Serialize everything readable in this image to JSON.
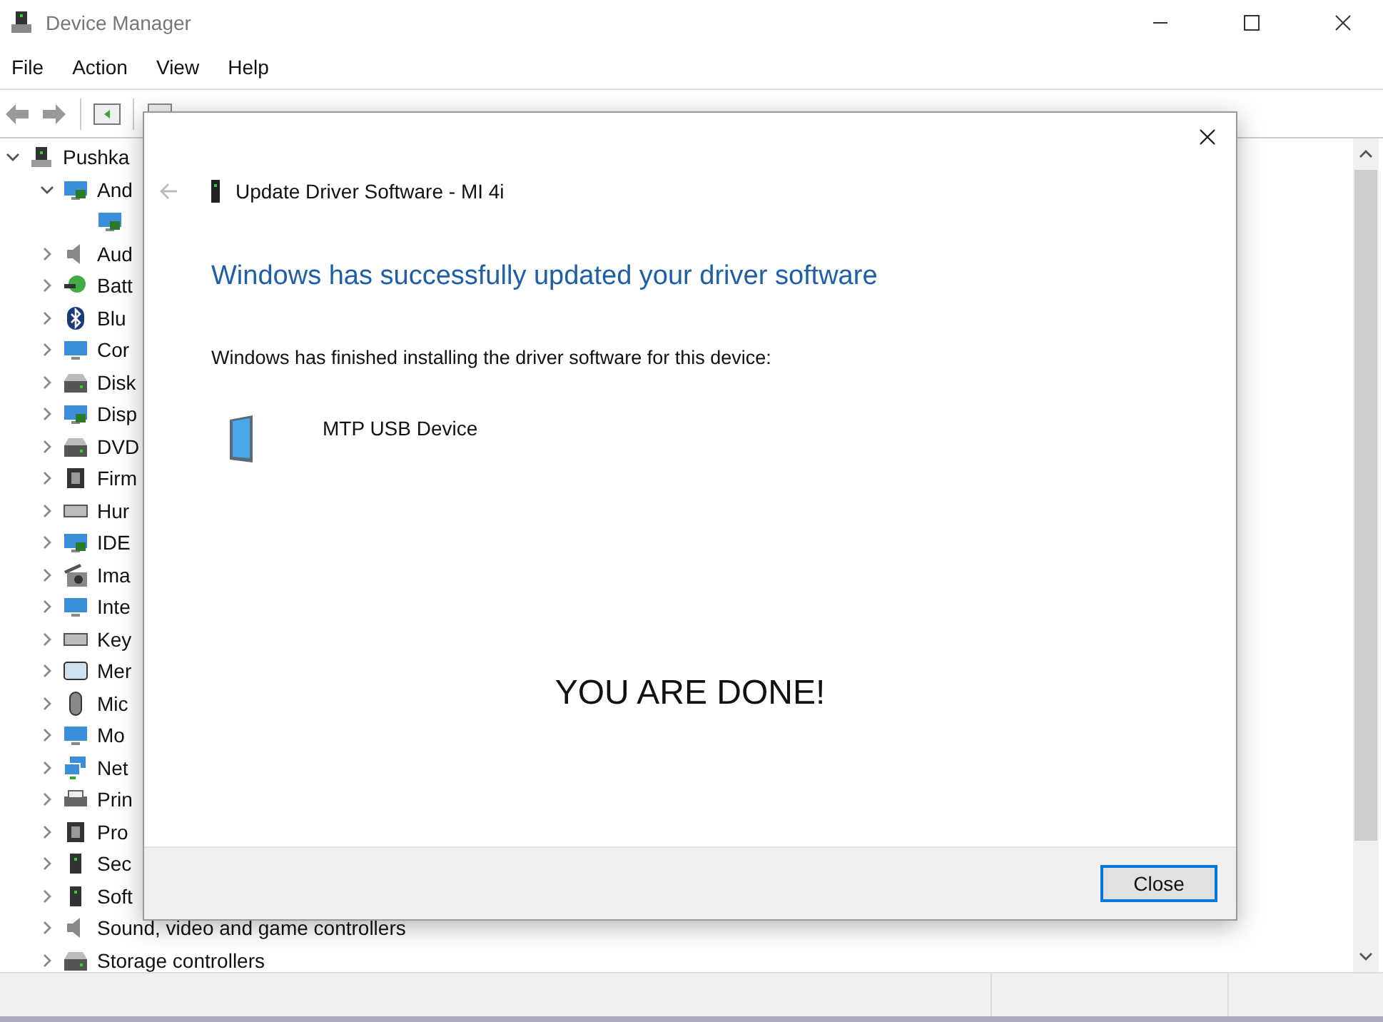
{
  "window": {
    "title": "Device Manager"
  },
  "menu": [
    "File",
    "Action",
    "View",
    "Help"
  ],
  "tree": [
    {
      "label": "Pushka",
      "kind": "computer",
      "expanded": true,
      "children": [
        {
          "label": "And",
          "kind": "display",
          "expanded": true,
          "children": [
            {
              "kind": "display"
            }
          ]
        },
        {
          "label": "Aud",
          "kind": "speaker",
          "expanded": false
        },
        {
          "label": "Batt",
          "kind": "battery",
          "expanded": false
        },
        {
          "label": "Blu",
          "kind": "bluetooth",
          "expanded": false
        },
        {
          "label": "Cor",
          "kind": "monitor",
          "expanded": false
        },
        {
          "label": "Disk",
          "kind": "disk",
          "expanded": false
        },
        {
          "label": "Disp",
          "kind": "display",
          "expanded": false
        },
        {
          "label": "DVD",
          "kind": "disk",
          "expanded": false
        },
        {
          "label": "Firm",
          "kind": "chip",
          "expanded": false
        },
        {
          "label": "Hur",
          "kind": "keyboard",
          "expanded": false
        },
        {
          "label": "IDE",
          "kind": "display",
          "expanded": false
        },
        {
          "label": "Ima",
          "kind": "camera",
          "expanded": false
        },
        {
          "label": "Inte",
          "kind": "monitor",
          "expanded": false
        },
        {
          "label": "Key",
          "kind": "keyboard",
          "expanded": false
        },
        {
          "label": "Mer",
          "kind": "card",
          "expanded": false
        },
        {
          "label": "Mic",
          "kind": "mouse",
          "expanded": false
        },
        {
          "label": "Mo",
          "kind": "monitor",
          "expanded": false
        },
        {
          "label": "Net",
          "kind": "network",
          "expanded": false
        },
        {
          "label": "Prin",
          "kind": "printer",
          "expanded": false
        },
        {
          "label": "Pro",
          "kind": "chip",
          "expanded": false
        },
        {
          "label": "Sec",
          "kind": "tower",
          "expanded": false
        },
        {
          "label": "Soft",
          "kind": "tower",
          "expanded": false
        },
        {
          "label": "Sound, video and game controllers",
          "kind": "speaker",
          "expanded": false
        },
        {
          "label": "Storage controllers",
          "kind": "disk",
          "expanded": false
        }
      ]
    }
  ],
  "dialog": {
    "title": "Update Driver Software - MI 4i",
    "heading": "Windows has successfully updated your driver software",
    "message": "Windows has finished installing the driver software for this device:",
    "device": "MTP USB Device",
    "note": "YOU ARE DONE!",
    "button": "Close"
  }
}
